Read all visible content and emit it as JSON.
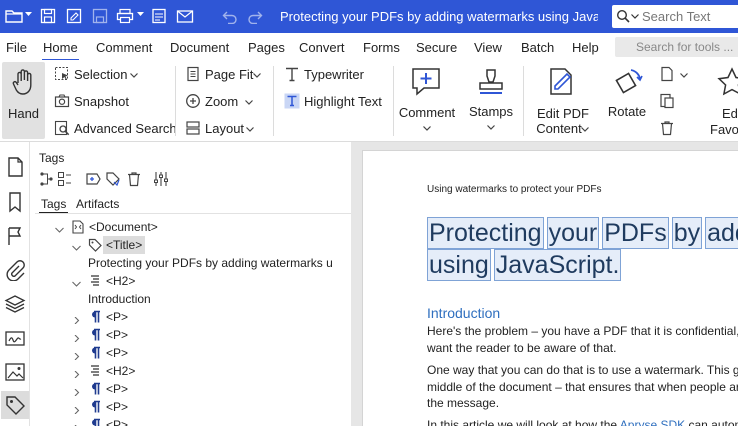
{
  "titlebar": {
    "title": "Protecting your PDFs by adding watermarks using JavaScri...",
    "search_placeholder": "Search Text"
  },
  "menu": {
    "items": [
      "File",
      "Home",
      "Comment",
      "Document",
      "Pages",
      "Convert",
      "Forms",
      "Secure",
      "View",
      "Batch",
      "Help"
    ],
    "active": "Home",
    "search_tools_placeholder": "Search for tools ..."
  },
  "ribbon": {
    "hand": "Hand",
    "selection": "Selection",
    "snapshot": "Snapshot",
    "advanced_search": "Advanced Search",
    "page_fit": "Page Fit",
    "zoom": "Zoom",
    "layout": "Layout",
    "typewriter": "Typewriter",
    "highlight_text": "Highlight Text",
    "comment": "Comment",
    "stamps": "Stamps",
    "edit_pdf_content_line1": "Edit PDF",
    "edit_pdf_content_line2": "Content",
    "rotate": "Rotate",
    "edit_favorites_line1": "Edi",
    "edit_favorites_line2": "Favo"
  },
  "panel": {
    "title": "Tags",
    "tabs": [
      "Tags",
      "Artifacts"
    ],
    "tree": [
      {
        "text": "<Document>",
        "icon": "document-tag-icon",
        "indent": 0,
        "chevron": "down"
      },
      {
        "text": "<Title>",
        "icon": "tag-icon",
        "indent": 1,
        "chevron": "down",
        "selected": true
      },
      {
        "text": "Protecting your PDFs by adding watermarks u",
        "icon": "",
        "indent": 2,
        "chevron": ""
      },
      {
        "text": "<H2>",
        "icon": "heading-icon",
        "indent": 1,
        "chevron": "down"
      },
      {
        "text": "Introduction",
        "icon": "",
        "indent": 2,
        "chevron": ""
      },
      {
        "text": "<P>",
        "icon": "paragraph-icon",
        "indent": 1,
        "chevron": "right"
      },
      {
        "text": "<P>",
        "icon": "paragraph-icon",
        "indent": 1,
        "chevron": "right"
      },
      {
        "text": "<P>",
        "icon": "paragraph-icon",
        "indent": 1,
        "chevron": "right"
      },
      {
        "text": "<H2>",
        "icon": "heading-icon",
        "indent": 1,
        "chevron": "right"
      },
      {
        "text": "<P>",
        "icon": "paragraph-icon",
        "indent": 1,
        "chevron": "right"
      },
      {
        "text": "<P>",
        "icon": "paragraph-icon",
        "indent": 1,
        "chevron": "right"
      },
      {
        "text": "<P>",
        "icon": "paragraph-icon",
        "indent": 1,
        "chevron": "right"
      }
    ]
  },
  "document": {
    "header": "Using watermarks to protect your PDFs",
    "title_line1": [
      "Protecting",
      "your",
      "PDFs",
      "by",
      "adding"
    ],
    "title_line2": [
      "using",
      "JavaScript."
    ],
    "h2": "Introduction",
    "p1_line1": "Here's the problem – you have a PDF that it is confidential, and s",
    "p1_line2": "want the reader to be aware of that.",
    "p2_line1": "One way that you can do that is to use a watermark. This gives a",
    "p2_line2": "middle of the document – that ensures that when people are wo",
    "p2_line3": "the message.",
    "p3_before": "In this article we will look at how the ",
    "p3_link": "Apryse SDK",
    "p3_after": " can automatica"
  },
  "colors": {
    "titlebar": "#2f56d6",
    "heading": "#2f6fbf",
    "selection": "#7fa3d6"
  }
}
